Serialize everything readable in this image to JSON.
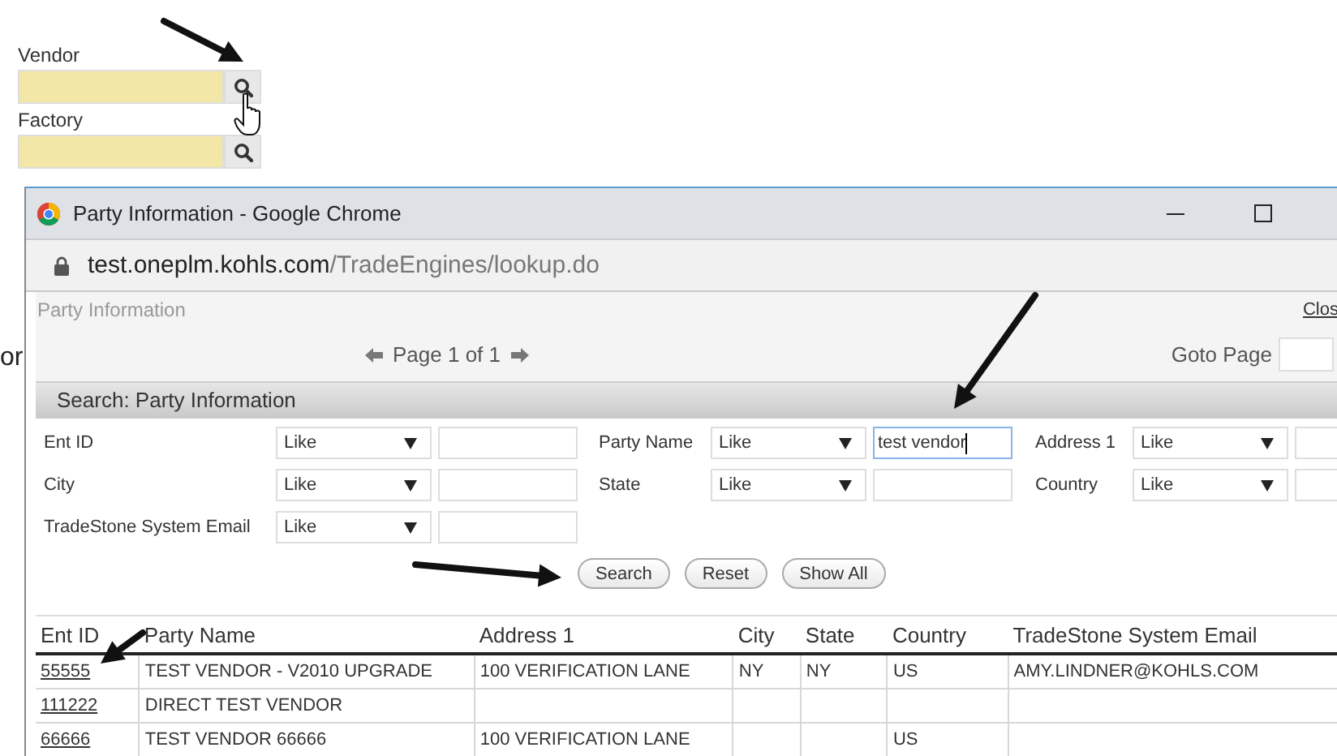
{
  "background_form": {
    "fields": [
      {
        "label": "Vendor"
      },
      {
        "label": "Factory"
      }
    ],
    "partial_text": "or"
  },
  "window": {
    "title": "Party Information - Google Chrome",
    "url_host": "test.oneplm.kohls.com",
    "url_path": "/TradeEngines/lookup.do"
  },
  "page": {
    "title": "Party Information",
    "close_link": "Clos",
    "pager": "Page 1 of 1",
    "goto_label": "Goto Page"
  },
  "search": {
    "title": "Search: Party Information",
    "filters": [
      {
        "label": "Ent ID",
        "operator": "Like",
        "focused": false
      },
      {
        "label": "Party Name",
        "operator": "Like",
        "value": "test vendor",
        "focused": true
      },
      {
        "label": "Address 1",
        "operator": "Like",
        "focused": false
      },
      {
        "label": "City",
        "operator": "Like",
        "focused": false
      },
      {
        "label": "State",
        "operator": "Like",
        "focused": false
      },
      {
        "label": "Country",
        "operator": "Like",
        "focused": false
      },
      {
        "label": "TradeStone System Email",
        "operator": "Like",
        "focused": false
      }
    ],
    "buttons": [
      "Search",
      "Reset",
      "Show All"
    ]
  },
  "table": {
    "columns": [
      "Ent ID",
      "Party Name",
      "Address 1",
      "City",
      "State",
      "Country",
      "TradeStone System Email"
    ],
    "rows": [
      {
        "ent_id": "55555",
        "party_name": "TEST VENDOR - V2010 UPGRADE",
        "address_1": "100 VERIFICATION LANE",
        "city": "NY",
        "state": "NY",
        "country": "US",
        "email": "AMY.LINDNER@KOHLS.COM"
      },
      {
        "ent_id": "111222",
        "party_name": "DIRECT TEST VENDOR"
      },
      {
        "ent_id": "66666",
        "party_name": "TEST VENDOR 66666",
        "address_1": "100 VERIFICATION LANE",
        "country": "US"
      }
    ]
  }
}
